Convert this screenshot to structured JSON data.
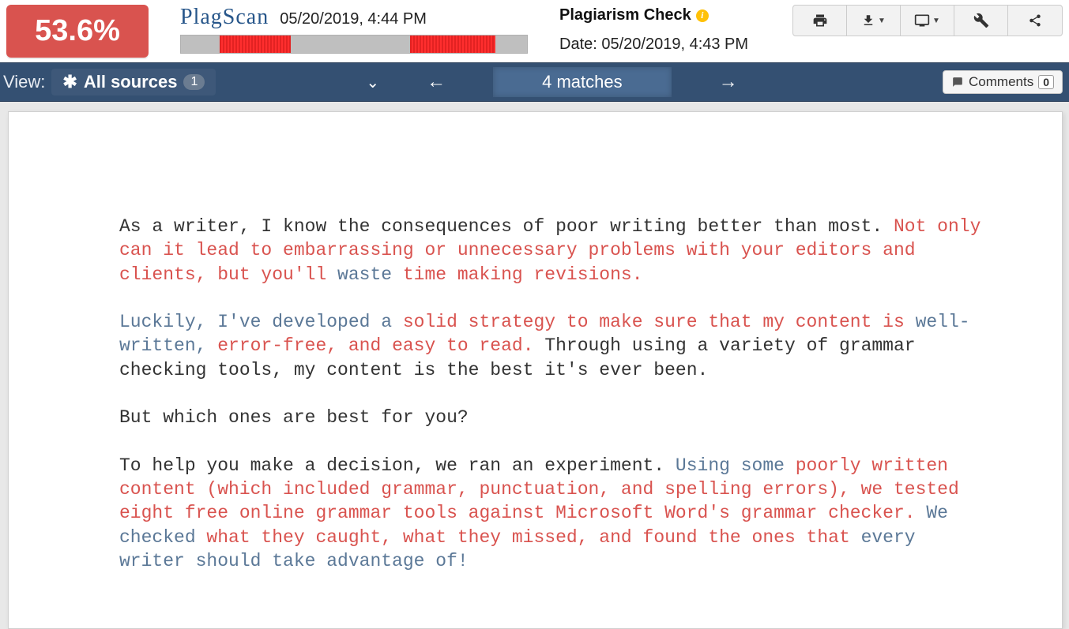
{
  "badge": {
    "percent": "53.6%"
  },
  "logo": {
    "text": "PlagScan"
  },
  "top_timestamp": "05/20/2019, 4:44 PM",
  "info": {
    "title": "Plagiarism Check",
    "date_label": "Date: 05/20/2019, 4:43 PM"
  },
  "navbar": {
    "view_label": "View:",
    "sources_label": "All sources",
    "sources_count": "1",
    "matches_label": "4 matches",
    "comments_label": "Comments",
    "comments_count": "0"
  },
  "doc": {
    "p1_a": "As a writer, I know the consequences of poor writing better than most. ",
    "p1_b": "Not only can it lead to embarrassing or unnecessary problems with your editors and clients, but you'll ",
    "p1_c": "waste",
    "p1_d": " time making revisions.",
    "p2_a": "Luckily, I've developed a ",
    "p2_b": "solid strategy to make sure that my content is ",
    "p2_c": "well-written, ",
    "p2_d": "error-free, and easy to read. ",
    "p2_e": "Through using a variety of grammar checking tools, my content is the best it's ever been.",
    "p3": "But which ones are best for you?",
    "p4_a": "To help you make a decision, we ran an experiment. ",
    "p4_b": "Using some ",
    "p4_c": "poorly written content (which included grammar, punctuation, and spelling errors), we tested eight free online grammar tools against Microsoft Word's grammar checker. ",
    "p4_d": "We checked ",
    "p4_e": "what they caught, what they missed, and found the ones that ",
    "p4_f": "every writer should take advantage of!"
  }
}
